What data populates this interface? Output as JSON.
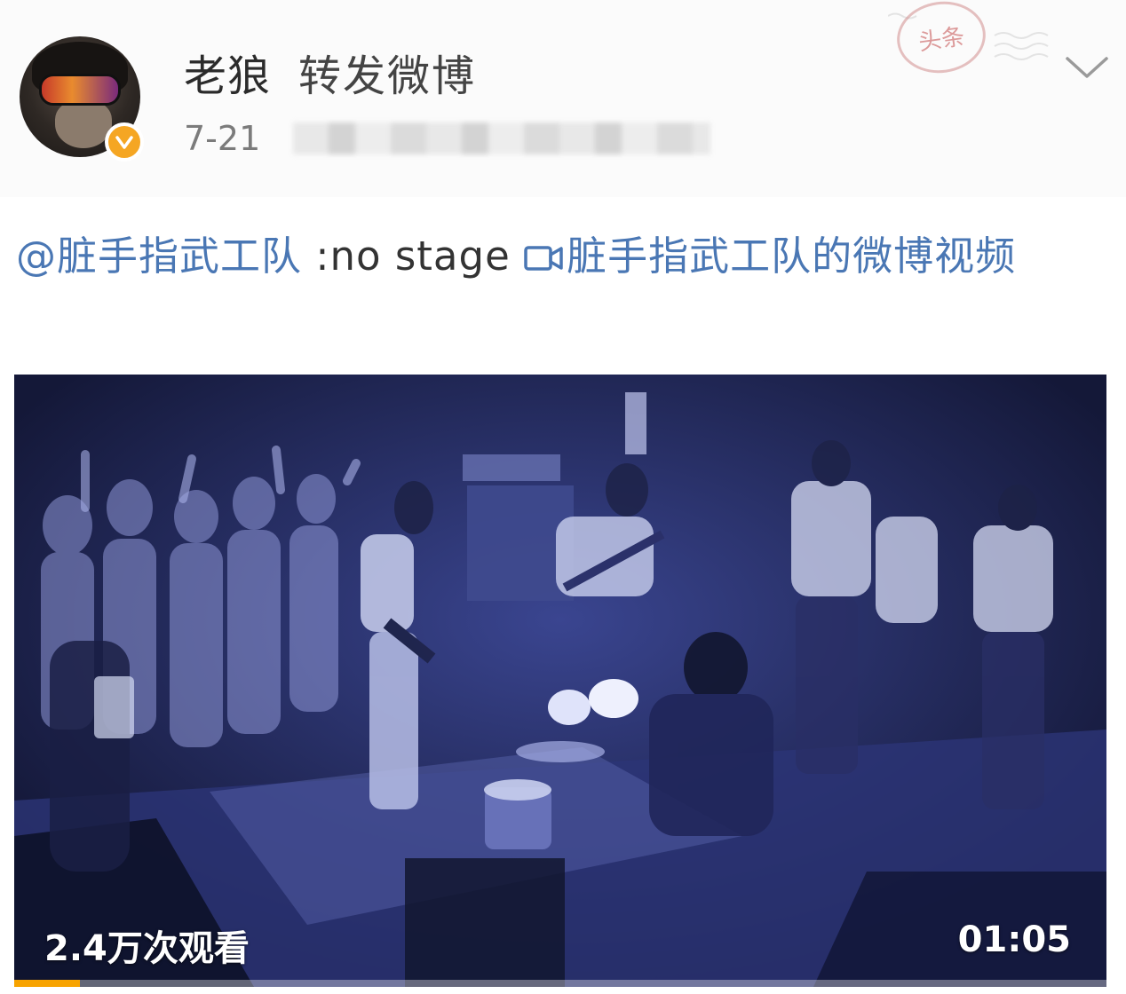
{
  "post": {
    "user_name": "老狼",
    "action_label": "转发微博",
    "date": "7-21",
    "stamp_text": "头条"
  },
  "content": {
    "mention": "@脏手指武工队",
    "text": " :no stage ",
    "video_link": "脏手指武工队的微博视频"
  },
  "video": {
    "view_count": "2.4万次观看",
    "duration": "01:05",
    "progress_fraction": 0.06,
    "accent_color": "#f7a300"
  },
  "icons": {
    "verified": "verified-badge-icon",
    "chevron": "chevron-down-icon",
    "video": "video-camera-icon"
  }
}
